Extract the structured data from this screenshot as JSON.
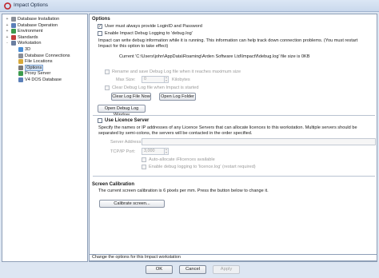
{
  "window": {
    "title": "Impact Options"
  },
  "tree": [
    {
      "label": "Database Installation",
      "expander": "+",
      "color": "#8a8f99",
      "depth": 0
    },
    {
      "label": "Database Operation",
      "expander": "+",
      "color": "#5b7fb8",
      "depth": 0
    },
    {
      "label": "Environment",
      "expander": "+",
      "color": "#3c9a4d",
      "depth": 0
    },
    {
      "label": "Standards",
      "expander": "+",
      "color": "#c23b3b",
      "depth": 0
    },
    {
      "label": "Workstation",
      "expander": "-",
      "color": "#6a7ea0",
      "depth": 0
    },
    {
      "label": "3D",
      "expander": "",
      "color": "#4b8fd6",
      "depth": 1
    },
    {
      "label": "Database Connections",
      "expander": "",
      "color": "#8a8f99",
      "depth": 1
    },
    {
      "label": "File Locations",
      "expander": "",
      "color": "#d8a93a",
      "depth": 1
    },
    {
      "label": "Options",
      "expander": "",
      "color": "#7a7a7a",
      "depth": 1,
      "selected": true
    },
    {
      "label": "Proxy Server",
      "expander": "",
      "color": "#3c9a4d",
      "depth": 1
    },
    {
      "label": "V4 DOS Database",
      "expander": "",
      "color": "#5b7fb8",
      "depth": 1
    }
  ],
  "options": {
    "heading": "Options",
    "login_label": "User must always provide LoginID and Password",
    "debug_label": "Enable Impact Debug Logging to 'debug.log'",
    "debug_info": "Impact can write debug information while it is running. This information can help track down connection problems. (You must restart Impact for this option to take effect)",
    "current_path": "Current 'C:\\Users\\john\\AppData\\Roaming\\Arden Software Ltd\\Impact\\f\\debug.log' file size is 0KB",
    "rename_label": "Rename and save Debug Log file when it reaches maximum size",
    "maxsize_label": "Max Size:",
    "maxsize_value": "0",
    "maxsize_unit": "Kilobytes",
    "clear_when_started": "Clear Debug Log file when Impact is started",
    "clear_now_button": "Clear Log File Now",
    "open_folder_button": "Open Log Folder",
    "open_window_button": "Open Debug Log Window"
  },
  "licence": {
    "label": "Use Licence Server",
    "description": "Specify the names or IP addresses of any Licence Servers that can allocate licences to this workstation. Multiple servers should be separated by semi-colons, the servers will be contacted in the order specified.",
    "server_label": "Server Address:",
    "server_value": "",
    "port_label": "TCP/IP Port:",
    "port_value": "3,000",
    "auto_allocate": "Auto-allocate iFlicences available",
    "enable_debug": "Enable debug logging to 'licence.log' (restart required)"
  },
  "calibration": {
    "heading": "Screen Calibration",
    "text": "The current screen calibration is 6 pixels per mm. Press the button below to change it.",
    "button": "Calibrate screen..."
  },
  "status": "Change the options for this Impact workstation",
  "buttons": {
    "ok": "OK",
    "cancel": "Cancel",
    "apply": "Apply"
  },
  "colors": {
    "title_bar": "#c9d8ec",
    "selection": "#cfe0f5",
    "window_bg": "#dde6f2"
  }
}
